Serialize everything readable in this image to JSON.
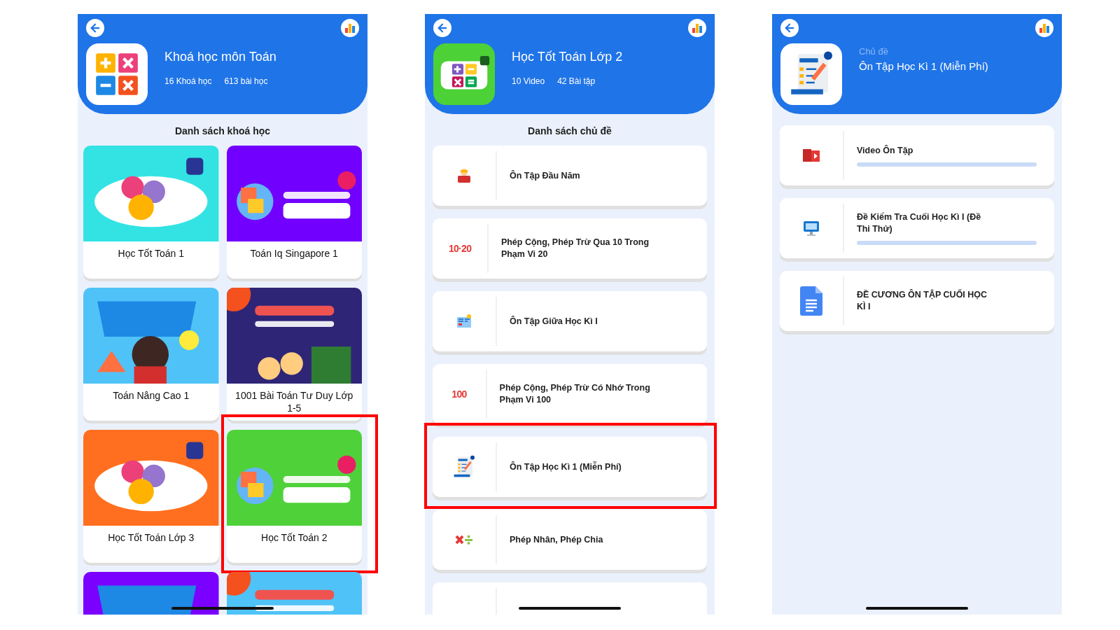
{
  "screens": [
    {
      "kind": "courses",
      "header": {
        "title": "Khoá học môn Toán",
        "stats": [
          "16 Khoá học",
          "613 bài học"
        ]
      },
      "section_title": "Danh sách khoá học",
      "courses": [
        {
          "title": "Học Tốt Toán 1",
          "highlighted": false
        },
        {
          "title": "Toán Iq Singapore 1",
          "highlighted": false
        },
        {
          "title": "Toán Nâng Cao 1",
          "highlighted": false
        },
        {
          "title": "1001 Bài Toán Tư Duy Lớp 1-5",
          "highlighted": false
        },
        {
          "title": "Học Tốt Toán Lớp 3",
          "highlighted": false
        },
        {
          "title": "Học Tốt Toán 2",
          "highlighted": true
        },
        {
          "highlighted": false
        },
        {
          "highlighted": false
        }
      ]
    },
    {
      "kind": "topics",
      "header": {
        "title": "Học Tốt Toán Lớp 2",
        "stats": [
          "10 Video",
          "42 Bài tập"
        ]
      },
      "section_title": "Danh sách chủ đề",
      "topics": [
        {
          "title": "Ôn Tập Đầu Năm",
          "kind": "reader",
          "highlighted": false
        },
        {
          "title": "Phép Cộng, Phép Trừ Qua 10 Trong Phạm Vi 20",
          "kind": "numbers",
          "icon_text": "10·20",
          "highlighted": false
        },
        {
          "title": "Ôn Tập Giữa Học Kì I",
          "kind": "book",
          "highlighted": false
        },
        {
          "title": "Phép Cộng, Phép Trừ Có Nhớ Trong Phạm Vi 100",
          "kind": "numbers",
          "icon_text": "100",
          "highlighted": false
        },
        {
          "title": "Ôn Tập Học Kì 1 (Miễn Phí)",
          "kind": "exam",
          "highlighted": true
        },
        {
          "title": "Phép Nhân, Phép Chia",
          "kind": "operators",
          "highlighted": false
        },
        {
          "highlighted": false
        }
      ]
    },
    {
      "kind": "lessons",
      "header": {
        "subtitle": "Chủ đề",
        "title": "Ôn Tập Học Kì 1 (Miễn Phí)"
      },
      "lessons": [
        {
          "title": "Video Ôn Tập",
          "kind": "video",
          "level": 0
        },
        {
          "title": "Đề Kiểm Tra Cuối Học Kì I (Đề Thi Thử)",
          "kind": "monitor",
          "level": 0
        },
        {
          "title": "ĐỀ CƯƠNG ÔN TẬP CUỐI HỌC KÌ I",
          "kind": "document"
        }
      ]
    }
  ]
}
